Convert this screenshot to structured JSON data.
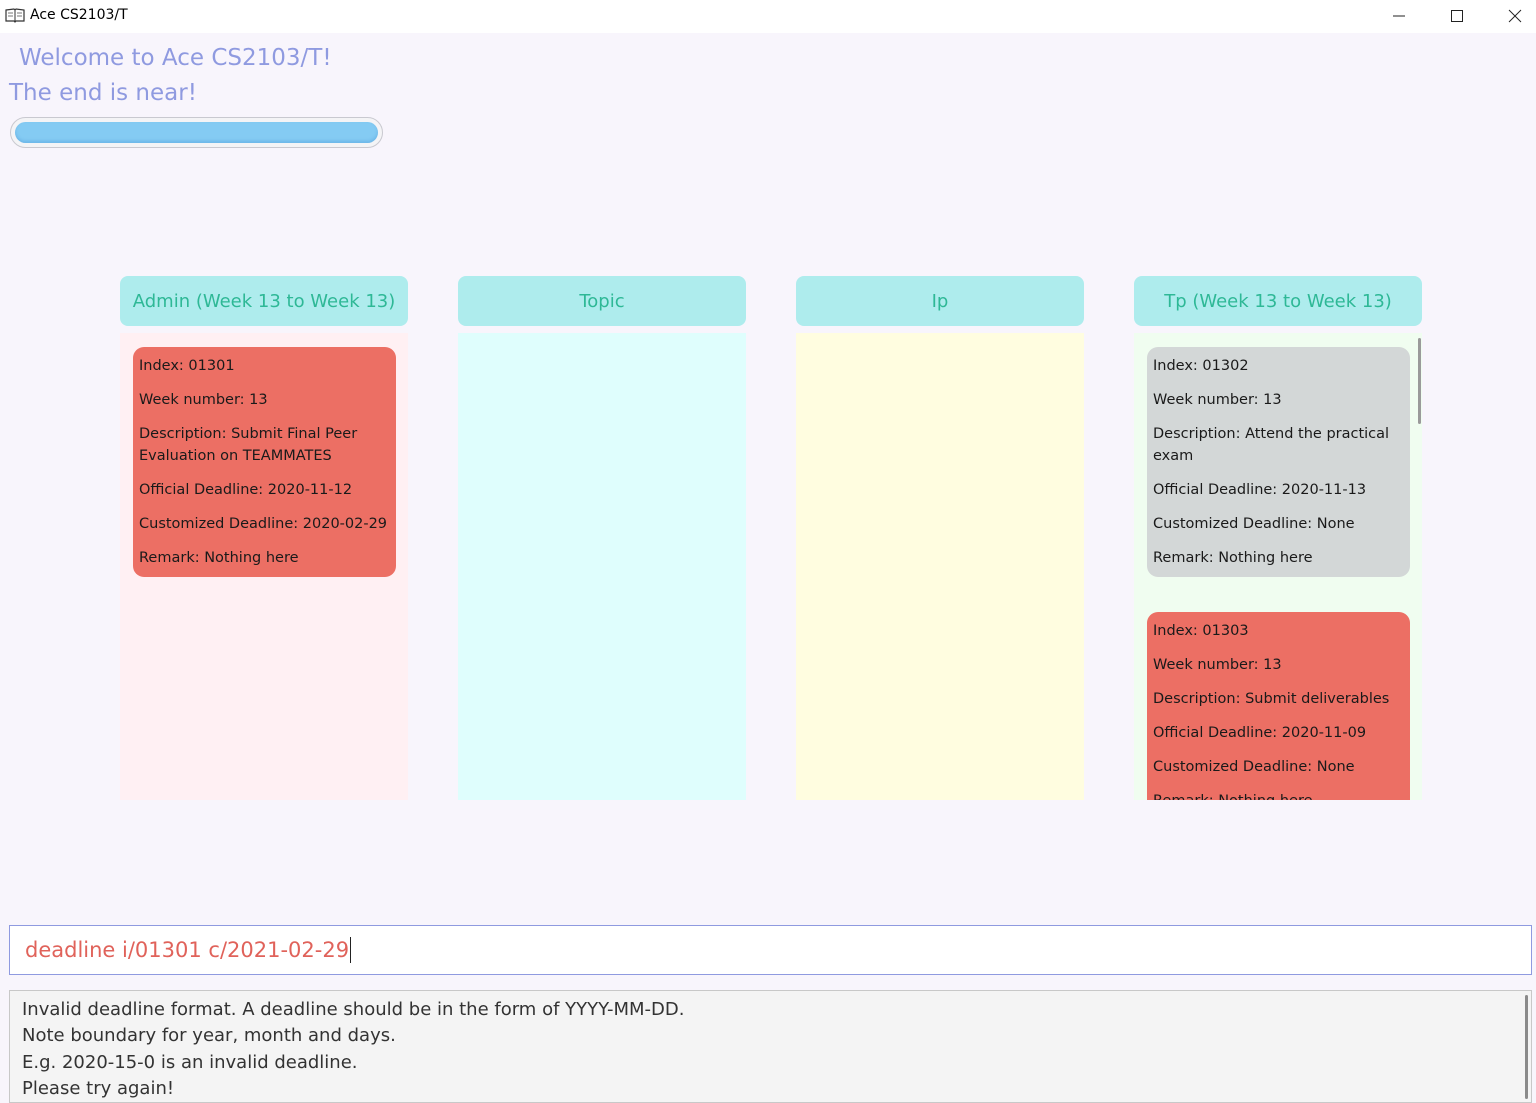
{
  "window": {
    "title": "Ace CS2103/T",
    "icon": "book-icon",
    "controls": [
      "minimize-icon",
      "maximize-icon",
      "close-icon"
    ]
  },
  "header": {
    "welcome": "Welcome to Ace CS2103/T!",
    "subtitle": "The end is near!",
    "progress_fraction": 1.0
  },
  "columns": [
    {
      "title": "Admin (Week 13 to Week 13)",
      "color": "#fff0f3",
      "cards": [
        {
          "color": "#ec6f64",
          "lines": [
            "Index: 01301",
            "Week number: 13",
            "Description: Submit Final Peer Evaluation on TEAMMATES",
            "Official Deadline: 2020-11-12",
            "Customized Deadline: 2020-02-29",
            "Remark: Nothing here"
          ]
        }
      ]
    },
    {
      "title": "Topic",
      "color": "#dffefd",
      "cards": []
    },
    {
      "title": "Ip",
      "color": "#fffde0",
      "cards": []
    },
    {
      "title": "Tp (Week 13 to Week 13)",
      "color": "#f0fdf0",
      "cards": [
        {
          "color": "#d3d7d7",
          "lines": [
            "Index: 01302",
            "Week number: 13",
            "Description: Attend the practical exam",
            "Official Deadline: 2020-11-13",
            "Customized Deadline: None",
            "Remark: Nothing here"
          ]
        },
        {
          "color": "#ec6f64",
          "lines": [
            "Index: 01303",
            "Week number: 13",
            "Description: Submit deliverables",
            "Official Deadline: 2020-11-09",
            "Customized Deadline: None",
            "Remark: Nothing here"
          ]
        }
      ]
    }
  ],
  "command": {
    "value": "deadline i/01301 c/2021-02-29"
  },
  "result": {
    "lines": [
      "Invalid deadline format. A deadline should be in the form of YYYY-MM-DD.",
      "Note boundary for year, month and days.",
      "E.g. 2020-15-0 is an invalid deadline.",
      "Please try again!"
    ]
  },
  "colors": {
    "accent": "#8f9ae0",
    "header_text": "#2eb896",
    "header_bg": "#aeeced",
    "command_text": "#e0625a"
  }
}
